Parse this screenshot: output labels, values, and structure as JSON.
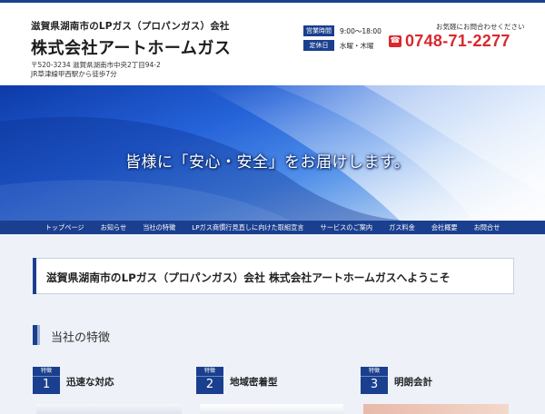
{
  "header": {
    "tagline": "滋賀県湖南市のLPガス（プロパンガス）会社",
    "company": "株式会社アートホームガス",
    "address_line1": "〒520-3234 滋賀県湖南市中央2丁目94-2",
    "address_line2": "JR草津線甲西駅から徒歩7分",
    "hours_label": "営業時間",
    "hours_value": "9:00～18:00",
    "holiday_label": "定休日",
    "holiday_value": "水曜・木曜",
    "contact_label": "お気軽にお問合わせください",
    "phone": "0748-71-2277"
  },
  "hero": {
    "slogan": "皆様に「安心・安全」をお届けします。"
  },
  "nav": {
    "items": [
      "トップページ",
      "お知らせ",
      "当社の特徴",
      "LPガス商慣行見直しに向けた取組宣言",
      "サービスのご案内",
      "ガス料金",
      "会社概要",
      "お問合せ"
    ]
  },
  "main": {
    "welcome": "滋賀県湖南市のLPガス（プロパンガス）会社 株式会社アートホームガスへようこそ",
    "section_title": "当社の特徴",
    "features": [
      {
        "badge": "特徴",
        "num": "1",
        "title": "迅速な対応"
      },
      {
        "badge": "特徴",
        "num": "2",
        "title": "地域密着型"
      },
      {
        "badge": "特徴",
        "num": "3",
        "title": "明朗会計"
      }
    ]
  },
  "colors": {
    "brand": "#1a3f8f",
    "phone": "#d9282f"
  }
}
